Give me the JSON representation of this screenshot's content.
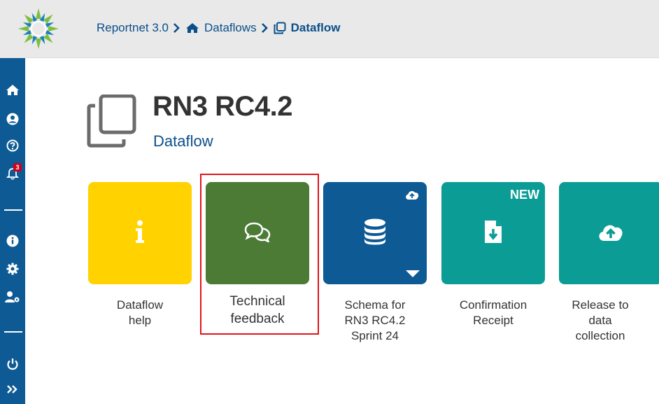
{
  "breadcrumb": {
    "items": [
      {
        "label": "Reportnet 3.0",
        "icon": "none"
      },
      {
        "label": "Dataflows",
        "icon": "home-icon"
      },
      {
        "label": "Dataflow",
        "icon": "clone-icon"
      }
    ]
  },
  "sidebar": {
    "notification_count": "3",
    "icons": [
      "home-icon",
      "user-icon",
      "help-icon",
      "bell-icon",
      "info-icon",
      "gear-icon",
      "user-settings-icon",
      "power-icon",
      "expand-icon"
    ]
  },
  "header": {
    "title": "RN3 RC4.2",
    "subtitle": "Dataflow"
  },
  "tiles": [
    {
      "label_line1": "Dataflow",
      "label_line2": "help",
      "label_line3": "",
      "color": "#ffd200",
      "icon": "info-icon"
    },
    {
      "label_line1": "Technical",
      "label_line2": "feedback",
      "label_line3": "",
      "color": "#4b7b35",
      "icon": "comments-icon"
    },
    {
      "label_line1": "Schema for",
      "label_line2": "RN3 RC4.2",
      "label_line3": "Sprint 24",
      "color": "#0e5a94",
      "icon": "database-icon"
    },
    {
      "label_line1": "Confirmation",
      "label_line2": "Receipt",
      "label_line3": "",
      "color": "#0c9c96",
      "icon": "file-download-icon",
      "tag": "NEW"
    },
    {
      "label_line1": "Release to",
      "label_line2": "data",
      "label_line3": "collection",
      "color": "#0c9c96",
      "icon": "cloud-upload-icon"
    }
  ],
  "colors": {
    "topbar": "#e9e9e9",
    "sidebar": "#0e5a94",
    "link": "#0b4f8a",
    "highlight": "#e1141b"
  }
}
